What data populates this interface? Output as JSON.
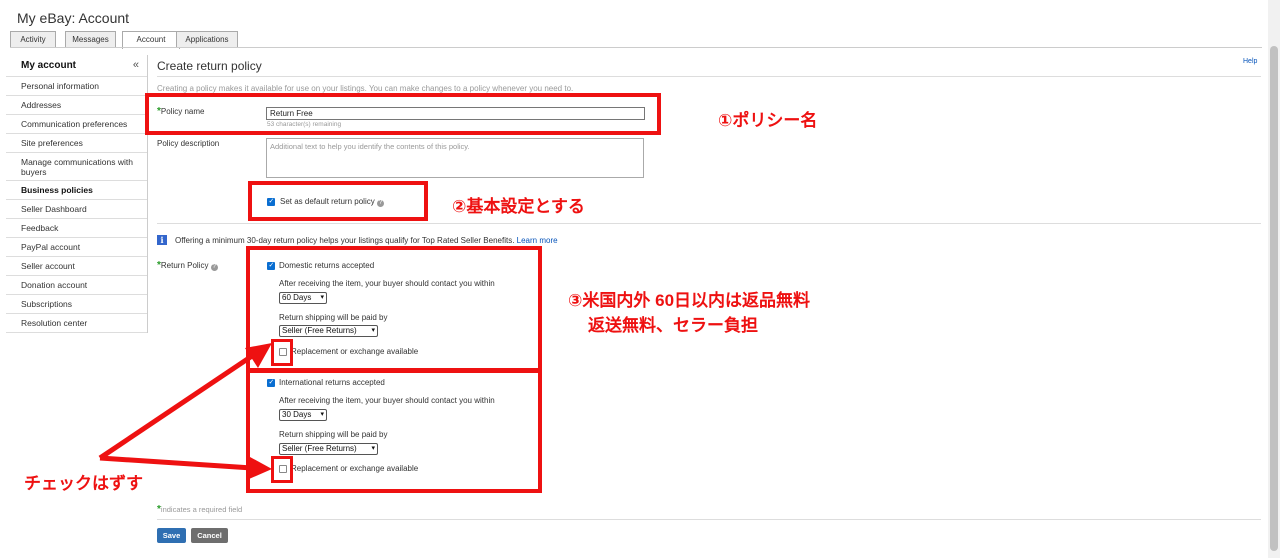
{
  "header": {
    "title": "My eBay: Account",
    "tabs": [
      {
        "label": "Activity",
        "active": false
      },
      {
        "label": "Messages",
        "active": false
      },
      {
        "label": "Account",
        "active": true
      },
      {
        "label": "Applications",
        "active": false
      }
    ]
  },
  "sidebar": {
    "title": "My account",
    "collapse": "«",
    "items": [
      {
        "label": "Personal information"
      },
      {
        "label": "Addresses"
      },
      {
        "label": "Communication preferences"
      },
      {
        "label": "Site preferences"
      },
      {
        "label": "Manage communications with buyers"
      },
      {
        "label": "Business policies",
        "active": true
      },
      {
        "label": "Seller Dashboard"
      },
      {
        "label": "Feedback"
      },
      {
        "label": "PayPal account"
      },
      {
        "label": "Seller account"
      },
      {
        "label": "Donation account"
      },
      {
        "label": "Subscriptions"
      },
      {
        "label": "Resolution center"
      }
    ]
  },
  "main": {
    "title": "Create return policy",
    "help": "Help",
    "subtitle": "Creating a policy makes it available for use on your listings. You can make changes to a policy whenever you need to.",
    "policy_name": {
      "star": "*",
      "label": "Policy name",
      "value": "Return Free",
      "remaining": "53 character(s) remaining"
    },
    "policy_description": {
      "label": "Policy description",
      "placeholder": "Additional text to help you identify the contents of this policy."
    },
    "default_policy": {
      "label": "Set as default return policy",
      "checked": true
    },
    "info": {
      "text": "Offering a minimum 30-day return policy helps your listings qualify for Top Rated Seller Benefits.",
      "link": "Learn more"
    },
    "return_policy": {
      "star": "*",
      "label": "Return Policy",
      "domestic": {
        "checkbox_label": "Domestic returns accepted",
        "checked": true,
        "contact_label": "After receiving the item, your buyer should contact you within",
        "contact_value": "60 Days",
        "shipping_label": "Return shipping will be paid by",
        "shipping_value": "Seller (Free Returns)",
        "replacement_label": "Replacement or exchange available",
        "replacement_checked": false
      },
      "international": {
        "checkbox_label": "International returns accepted",
        "checked": true,
        "contact_label": "After receiving the item, your buyer should contact you within",
        "contact_value": "30 Days",
        "shipping_label": "Return shipping will be paid by",
        "shipping_value": "Seller (Free Returns)",
        "replacement_label": "Replacement or exchange available",
        "replacement_checked": false
      }
    },
    "required_note": {
      "star": "*",
      "text": "indicates a required field"
    },
    "save_label": "Save",
    "cancel_label": "Cancel"
  },
  "annotations": {
    "a1": "①ポリシー名",
    "a2": "②基本設定とする",
    "a3_line1": "③米国内外 60日以内は返品無料",
    "a3_line2": "返送無料、セラー負担",
    "a4": "チェックはずす"
  },
  "colors": {
    "annotation_red": "#ee1111",
    "link_blue": "#0654ba",
    "checkbox_blue": "#0a6ed1",
    "required_green": "#2a9c2a",
    "save_button": "#2f6fb2",
    "cancel_button": "#6e6e6e"
  }
}
